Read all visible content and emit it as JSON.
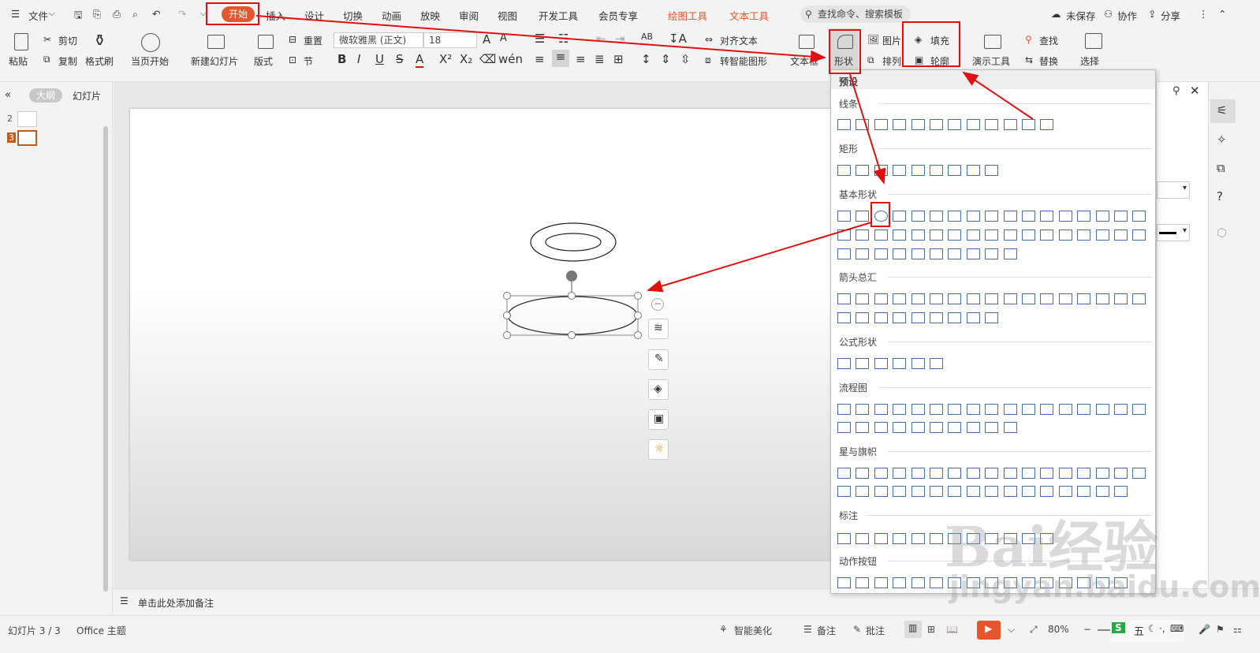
{
  "menubar": {
    "file": "文件",
    "tabs": [
      "开始",
      "插入",
      "设计",
      "切换",
      "动画",
      "放映",
      "审阅",
      "视图",
      "开发工具",
      "会员专享"
    ],
    "ctx_tabs": [
      "绘图工具",
      "文本工具"
    ],
    "search": "查找命令、搜索模板",
    "unsaved": "未保存",
    "collab": "协作",
    "share": "分享"
  },
  "ribbon": {
    "paste": "粘贴",
    "cut": "剪切",
    "copy": "复制",
    "format_painter": "格式刷",
    "from_start": "当页开始",
    "new_slide": "新建幻灯片",
    "layout": "版式",
    "reset": "重置",
    "section": "节",
    "font": "微软雅黑 (正文)",
    "size": "18",
    "align_text": "对齐文本",
    "smartart": "转智能图形",
    "textbox": "文本框",
    "shape": "形状",
    "picture": "图片",
    "arrange": "排列",
    "fill": "填充",
    "outline": "轮廓",
    "presentation_tools": "演示工具",
    "find": "查找",
    "replace": "替换",
    "select": "选择"
  },
  "leftpane": {
    "outline_tab": "大纲",
    "slides_tab": "幻灯片",
    "slide_nums": [
      "2",
      "3"
    ]
  },
  "notes": "单击此处添加备注",
  "status": {
    "slide_count": "幻灯片 3 / 3",
    "theme": "Office 主题",
    "beautify": "智能美化",
    "notes": "备注",
    "comments": "批注",
    "zoom": "80%"
  },
  "dropdown": {
    "preset": "预设",
    "sections": [
      "线条",
      "矩形",
      "基本形状",
      "箭头总汇",
      "公式形状",
      "流程图",
      "星与旗帜",
      "标注",
      "动作按钮"
    ]
  },
  "watermark": {
    "brand": "Bai经验",
    "url": "jingyan.baidu.com"
  },
  "colors": {
    "accent": "#e4572e",
    "annotation": "#e01010",
    "shape_stroke": "#4a6ea9"
  }
}
